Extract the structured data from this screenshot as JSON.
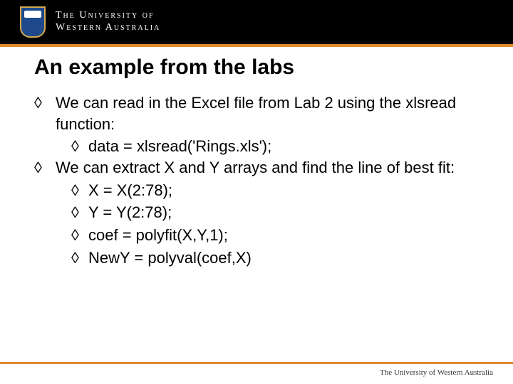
{
  "header": {
    "wordmark_line1": "The University of",
    "wordmark_line2": "Western Australia"
  },
  "slide": {
    "title": "An example from the labs",
    "bullets": [
      {
        "text": "We can read in the Excel file from Lab 2 using the xlsread function:",
        "sub": [
          {
            "text": "data  = xlsread('Rings.xls');"
          }
        ]
      },
      {
        "text": "We can extract X and Y arrays and find the line of best fit:",
        "sub": [
          {
            "text": "X = X(2:78);"
          },
          {
            "text": "Y = Y(2:78);"
          },
          {
            "text": "coef = polyfit(X,Y,1);"
          },
          {
            "text": "NewY = polyval(coef,X)"
          }
        ]
      }
    ]
  },
  "footer": {
    "text": "The University of Western Australia"
  },
  "glyphs": {
    "diamond": "◊"
  }
}
